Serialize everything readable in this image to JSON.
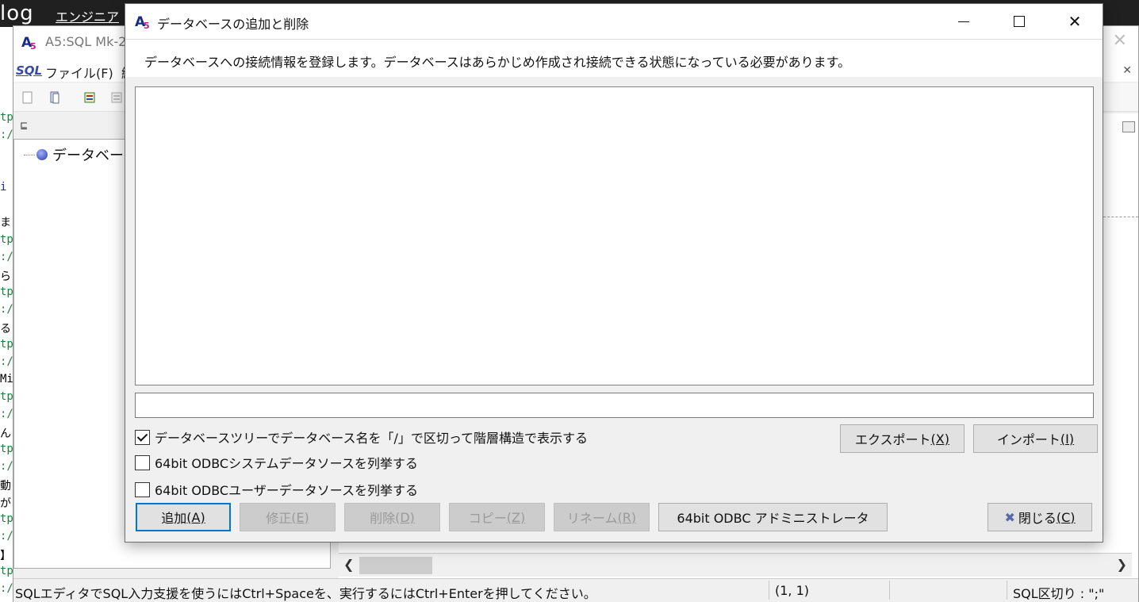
{
  "background": {
    "logo": "log",
    "nav_label": "エンジニア",
    "code_gutter": [
      {
        "text": "tp",
        "color": "green"
      },
      {
        "text": ":/",
        "color": "green"
      },
      {
        "text": "i",
        "color": "blue"
      },
      {
        "text": "ま",
        "color": "black"
      },
      {
        "text": "tp",
        "color": "green"
      },
      {
        "text": ":/",
        "color": "green"
      },
      {
        "text": "ら",
        "color": "black"
      },
      {
        "text": "tp",
        "color": "green"
      },
      {
        "text": ":/",
        "color": "green"
      },
      {
        "text": "る",
        "color": "black"
      },
      {
        "text": "tp",
        "color": "green"
      },
      {
        "text": ":/",
        "color": "green"
      },
      {
        "text": "Mi",
        "color": "black"
      },
      {
        "text": "tp",
        "color": "green"
      },
      {
        "text": ":/",
        "color": "green"
      },
      {
        "text": "ん",
        "color": "black"
      },
      {
        "text": "tp",
        "color": "green"
      },
      {
        "text": ":/",
        "color": "green"
      },
      {
        "text": "動",
        "color": "black"
      },
      {
        "text": "が",
        "color": "black"
      },
      {
        "text": "tp",
        "color": "green"
      },
      {
        "text": ":/",
        "color": "green"
      },
      {
        "text": "】",
        "color": "black"
      },
      {
        "text": "tp",
        "color": "green"
      },
      {
        "text": ":/",
        "color": "green"
      }
    ]
  },
  "main_window": {
    "title": "A5:SQL Mk-2",
    "menu": {
      "sql_label": "SQL",
      "file_label": "ファイル(F)",
      "next_label": "編"
    },
    "tree": {
      "root_label": "データベース"
    },
    "statusbar": {
      "message": "SQLエディタでSQL入力支援を使うにはCtrl+Spaceを、実行するにはCtrl+Enterを押してください。",
      "position": "(1, 1)",
      "sql_separator": "SQL区切り : \";\""
    }
  },
  "dialog": {
    "title": "データベースの追加と削除",
    "info_text": "データベースへの接続情報を登録します。データベースはあらかじめ作成され接続できる状態になっている必要があります。",
    "filter_value": "",
    "checkboxes": [
      {
        "label": "データベースツリーでデータベース名を「/」で区切って階層構造で表示する",
        "checked": true
      },
      {
        "label": "64bit ODBCシステムデータソースを列挙する",
        "checked": false
      },
      {
        "label": "64bit ODBCユーザーデータソースを列挙する",
        "checked": false
      }
    ],
    "buttons": {
      "export": {
        "text": "エクスポート",
        "mnemonic": "(X)"
      },
      "import": {
        "text": "インポート",
        "mnemonic": "(I)"
      },
      "add": {
        "text": "追加",
        "mnemonic": "(A)"
      },
      "edit": {
        "text": "修正",
        "mnemonic": "(E)"
      },
      "delete": {
        "text": "削除",
        "mnemonic": "(D)"
      },
      "copy": {
        "text": "コピー",
        "mnemonic": "(Z)"
      },
      "rename": {
        "text": "リネーム",
        "mnemonic": "(R)"
      },
      "odbc_admin": {
        "text": "64bit ODBC アドミニストレータ"
      },
      "close": {
        "text": "閉じる",
        "mnemonic": "(C)"
      }
    }
  },
  "colors": {
    "accent": "#0078d7",
    "code_green": "#1e7f3a",
    "code_blue": "#1a2f9c"
  }
}
